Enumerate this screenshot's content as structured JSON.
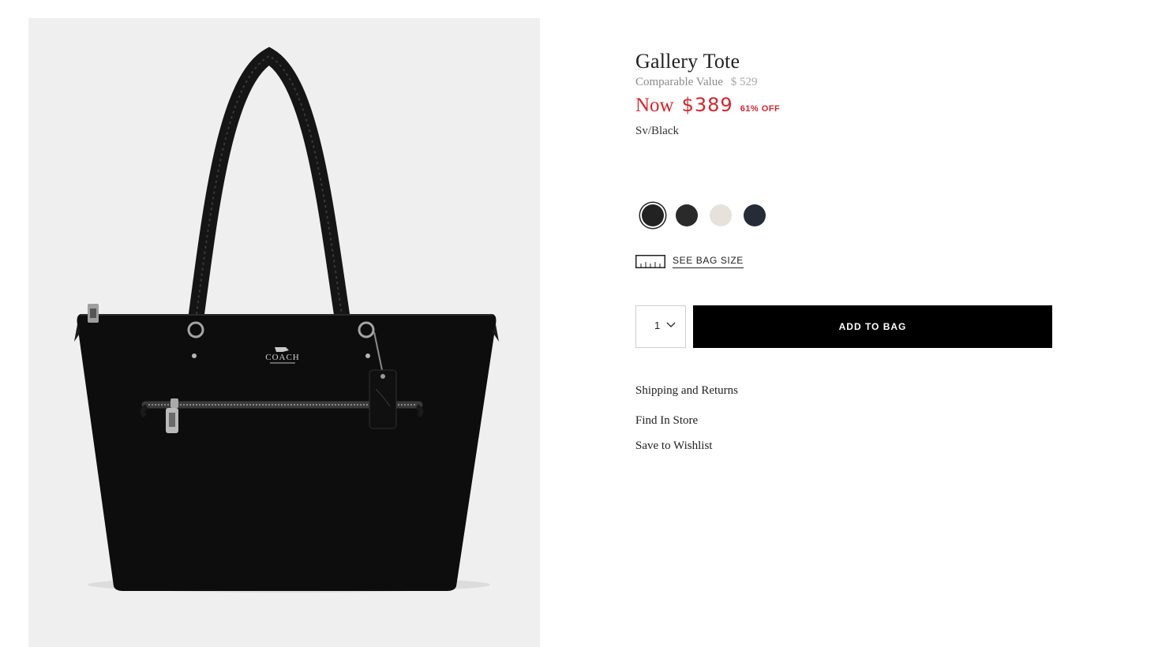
{
  "product": {
    "title": "Gallery Tote",
    "comparable_label": "Comparable Value",
    "comparable_price": "$ 529",
    "now_label": "Now",
    "now_price": "$389",
    "discount": "61% OFF",
    "color_name": "Sv/Black"
  },
  "swatches": [
    {
      "name": "black",
      "color": "#222222",
      "selected": true
    },
    {
      "name": "charcoal",
      "color": "#2a2a2a",
      "selected": false
    },
    {
      "name": "chalk",
      "color": "#e6e1db",
      "selected": false
    },
    {
      "name": "midnight",
      "color": "#262b38",
      "selected": false
    }
  ],
  "bag_size_link": "SEE BAG SIZE",
  "quantity": "1",
  "add_to_bag": "ADD TO BAG",
  "links": {
    "shipping": "Shipping and Returns",
    "find_store": "Find In Store",
    "wishlist": "Save to Wishlist"
  },
  "image": {
    "logo_text": "COACH"
  },
  "colors": {
    "sale_red": "#d9222a",
    "button_black": "#000000",
    "image_background": "#efefef"
  }
}
